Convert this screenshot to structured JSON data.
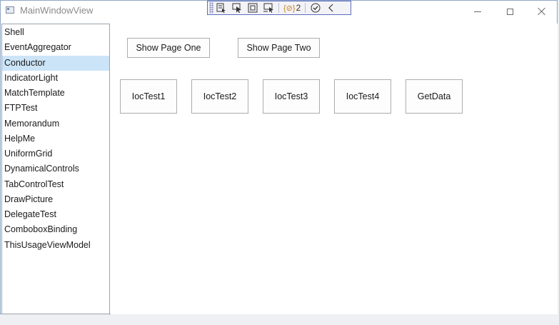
{
  "window": {
    "title": "MainWindowView"
  },
  "debug_toolbar": {
    "tools": [
      "select-element-icon",
      "pointer-icon",
      "frame-icon",
      "track-focus-icon"
    ],
    "binding_error_count": "2"
  },
  "nav": {
    "selected_index": 2,
    "items": [
      "Shell",
      "EventAggregator",
      "Conductor",
      "IndicatorLight",
      "MatchTemplate",
      "FTPTest",
      "Memorandum",
      "HelpMe",
      "UniformGrid",
      "DynamicalControls",
      "TabControlTest",
      "DrawPicture",
      "DelegateTest",
      "ComboboxBinding",
      "ThisUsageViewModel"
    ]
  },
  "content": {
    "show_page_one": "Show Page One",
    "show_page_two": "Show Page Two",
    "ioc_test_1": "IocTest1",
    "ioc_test_2": "IocTest2",
    "ioc_test_3": "IocTest3",
    "ioc_test_4": "IocTest4",
    "get_data": "GetData"
  },
  "colors": {
    "selection": "#cce4f7",
    "toolbar_border": "#5d6cc0",
    "window_border": "#8fa6c4"
  }
}
